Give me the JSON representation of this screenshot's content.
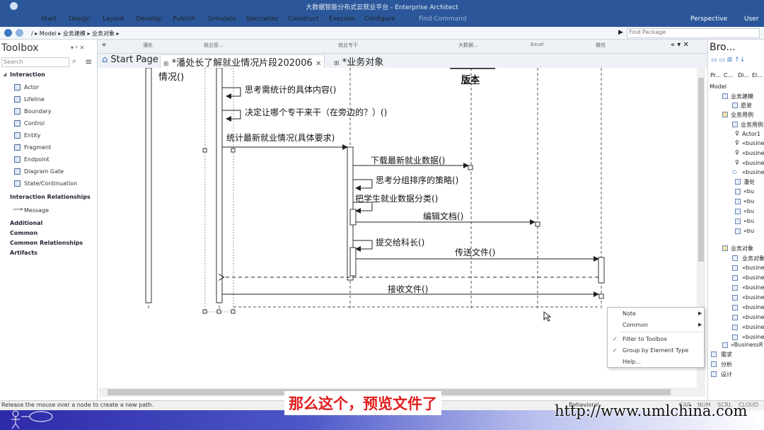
{
  "window": {
    "title": "大数据智能分布式云就业平台 - Enterprise Architect"
  },
  "ribbon": {
    "tabs": [
      "Start",
      "Design",
      "Layout",
      "Develop",
      "Publish",
      "Simulate",
      "Specialize",
      "Construct",
      "Execute",
      "Configure"
    ],
    "find_command": "Find Command",
    "perspective": "Perspective",
    "user": "User"
  },
  "address": {
    "breadcrumb": "/  ▸ Model  ▸ 业务建模  ▸ 业务对象  ▸",
    "find_package_placeholder": "Find Package"
  },
  "toolbox": {
    "title": "Toolbox",
    "search_placeholder": "Search",
    "interaction_section": "Interaction",
    "interaction_items": [
      "Actor",
      "Lifeline",
      "Boundary",
      "Control",
      "Entity",
      "Fragment",
      "Endpoint",
      "Diagram Gate",
      "State/Continuation"
    ],
    "relationships_section": "Interaction Relationships",
    "relationship_items": [
      "Message"
    ],
    "other_sections": [
      "Additional",
      "Common",
      "Common Relationships",
      "Artifacts"
    ]
  },
  "lifeline_headers": [
    "潘处",
    "就业管...",
    "就业专干",
    "大数据...",
    "Excel",
    "微信"
  ],
  "tabs": {
    "start_page": "Start Page",
    "diagram_tab": "*潘处长了解就业情况片段202006",
    "object_tab": "*业务对象"
  },
  "diagram": {
    "partial_title": "版本",
    "cut_label": "情况()",
    "messages": [
      "思考需统计的具体内容()",
      "决定让哪个专干来干（在旁边的？）()",
      "统计最新就业情况(具体要求)",
      "下载最新就业数据()",
      "思考分组排序的策略()",
      "把学生就业数据分类()",
      "编辑文档()",
      "提交给科长()",
      "传送文件()",
      "接收文件()"
    ]
  },
  "context_menu": {
    "items": [
      "Note",
      "Common",
      "Filter to Toolbox",
      "Group by Element Type",
      "Help..."
    ]
  },
  "browser": {
    "title": "Bro...",
    "tabs": [
      "Pr...",
      "C...",
      "Di...",
      "El..."
    ],
    "items": [
      "Model",
      "业务建模",
      "愿景",
      "业务用例",
      "业务用例",
      "Actor1",
      "«busine",
      "«busine",
      "«busine",
      "«busine",
      "潘处",
      "«bu",
      "«bu",
      "«bu",
      "«bu",
      "«bu",
      "业务对象",
      "业务对象",
      "«busine",
      "«busine",
      "«busine",
      "«busine",
      "«busine",
      "«busine",
      "«busine",
      "«busine",
      "«BusinessR",
      "需求",
      "分析",
      "设计"
    ]
  },
  "status": {
    "message": "Release the mouse over a node to create a new path.",
    "mode": "Behavioral",
    "indicators": [
      "CAP",
      "NUM",
      "SCRL",
      "CLOUD"
    ]
  },
  "overlay": {
    "subtitle": "那么这个，预览文件了",
    "url": "http://www.umlchina.com"
  },
  "colors": {
    "ribbon": "#2b579a",
    "subtitle": "#e21c1c"
  }
}
